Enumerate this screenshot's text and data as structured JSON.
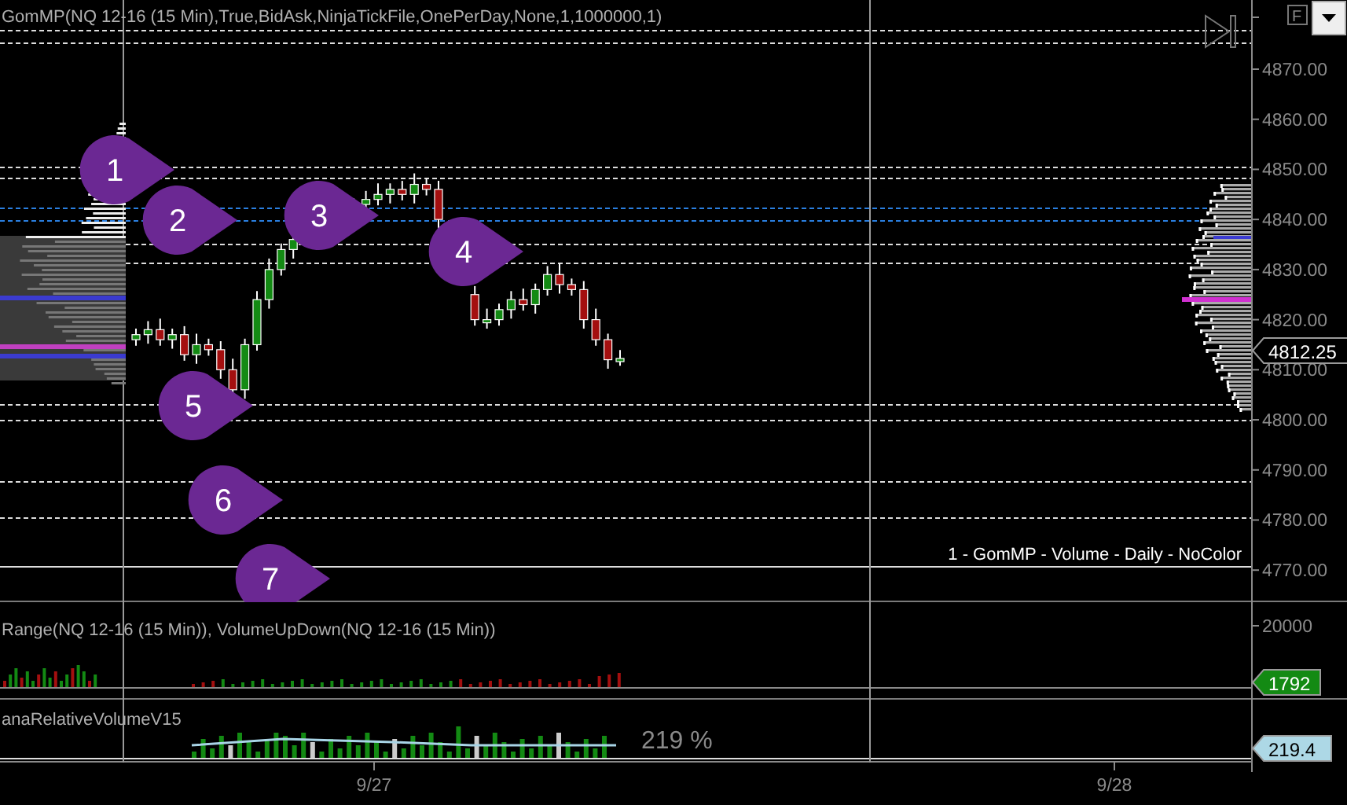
{
  "price_panel": {
    "indicator_label": "GomMP(NQ 12-16 (15 Min),True,BidAsk,NinjaTickFile,OnePerDay,None,1,1000000,1)",
    "float_button": "F",
    "profile_label": "1 - GomMP - Volume - Daily - NoColor",
    "last_price": "4812.25",
    "axis_ticks": [
      "4870.00",
      "4860.00",
      "4850.00",
      "4840.00",
      "4830.00",
      "4820.00",
      "4810.00",
      "4800.00",
      "4790.00",
      "4780.00",
      "4770.00"
    ],
    "markers": [
      {
        "label": "1"
      },
      {
        "label": "2"
      },
      {
        "label": "3"
      },
      {
        "label": "4"
      },
      {
        "label": "5"
      },
      {
        "label": "6"
      },
      {
        "label": "7"
      }
    ]
  },
  "volume_panel": {
    "indicator_label": "Range(NQ 12-16 (15 Min)), VolumeUpDown(NQ 12-16 (15 Min))",
    "axis_tick": "20000",
    "last_value": "1792"
  },
  "relative_volume_panel": {
    "indicator_label": "anaRelativeVolumeV15",
    "reading": "219 %",
    "last_value": "219.4"
  },
  "time_axis": {
    "ticks": [
      "9/27",
      "9/28"
    ]
  }
}
